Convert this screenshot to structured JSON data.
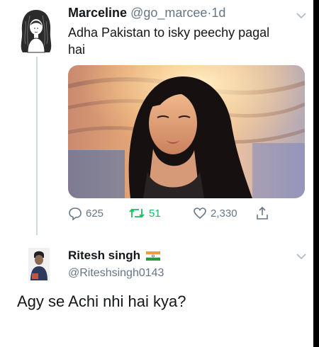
{
  "tweet": {
    "author_name": "Marceline",
    "handle": "@go_marcee",
    "separator": "·",
    "time": "1d",
    "text": "Adha Pakistan to isky peechy pagal hai",
    "stats": {
      "replies": "625",
      "retweets": "51",
      "likes": "2,330"
    }
  },
  "reply": {
    "author_name": "Ritesh singh",
    "handle": "@Riteshsingh0143",
    "text": "Agy se Achi nhi hai kya?"
  },
  "icons": {
    "reply": "comment-icon",
    "retweet": "retweet-icon",
    "like": "heart-icon",
    "share": "share-icon",
    "menu": "chevron-down-icon",
    "flag": "india-flag-icon"
  },
  "colors": {
    "text": "#14171a",
    "secondary": "#657786",
    "retweet": "#17bf63",
    "thread_line": "#cfd9de"
  }
}
